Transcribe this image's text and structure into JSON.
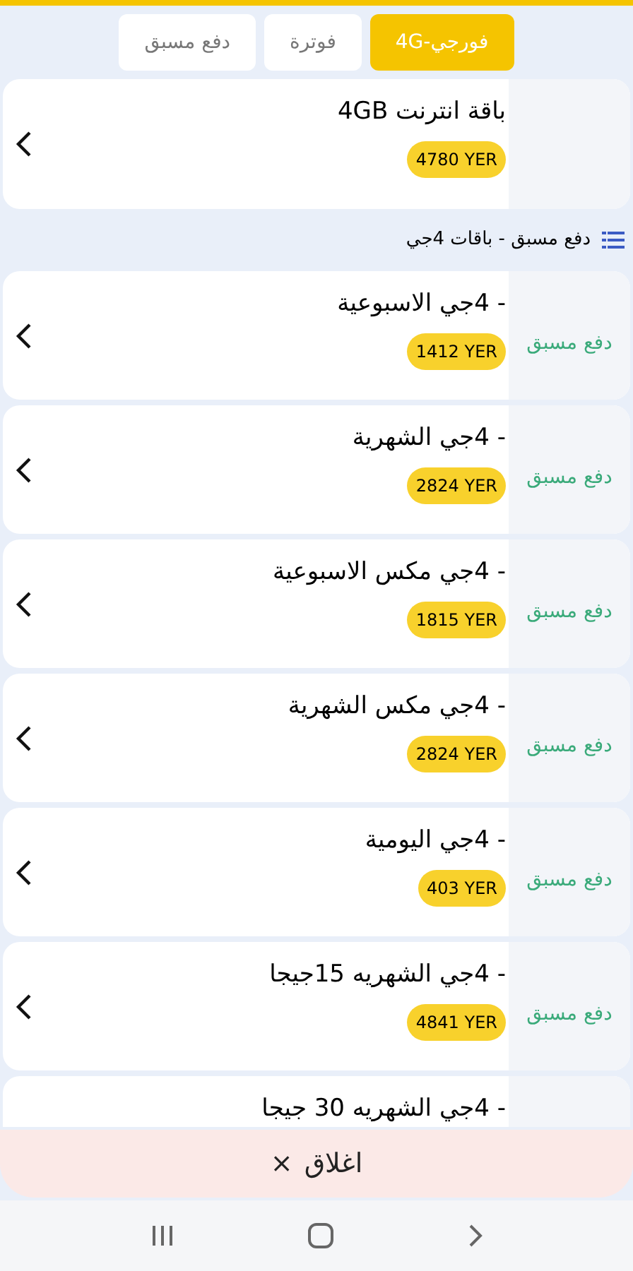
{
  "tabs": [
    {
      "label": "فورجي-4G",
      "selected": true
    },
    {
      "label": "فوترة",
      "selected": false
    },
    {
      "label": "دفع مسبق",
      "selected": false
    }
  ],
  "featured": {
    "title": "باقة انترنت 4GB",
    "price": "4780 YER"
  },
  "section_title": "دفع مسبق - باقات 4جي",
  "packages": [
    {
      "title": "- 4جي الاسبوعية",
      "price": "1412 YER",
      "label": "دفع مسبق"
    },
    {
      "title": "- 4جي الشهرية",
      "price": "2824 YER",
      "label": "دفع مسبق"
    },
    {
      "title": "- 4جي مكس الاسبوعية",
      "price": "1815 YER",
      "label": "دفع مسبق"
    },
    {
      "title": "- 4جي مكس الشهرية",
      "price": "2824 YER",
      "label": "دفع مسبق"
    },
    {
      "title": "- 4جي اليومية",
      "price": "403 YER",
      "label": "دفع مسبق"
    },
    {
      "title": "- 4جي الشهريه 15جيجا",
      "price": "4841 YER",
      "label": "دفع مسبق"
    },
    {
      "title": "- 4جي الشهريه 30 جيجا"
    }
  ],
  "close_button": {
    "icon": "×",
    "label": "اغلاق"
  }
}
